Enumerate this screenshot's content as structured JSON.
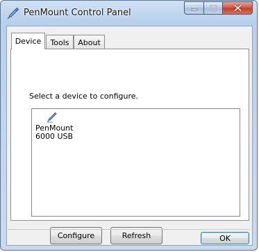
{
  "window": {
    "title": "PenMount Control Panel",
    "app_icon": "pen-icon",
    "caption_buttons": [
      "minimize-icon",
      "maximize-icon",
      "close-icon"
    ]
  },
  "tabs": [
    {
      "label": "Device",
      "selected": true
    },
    {
      "label": "Tools",
      "selected": false
    },
    {
      "label": "About",
      "selected": false
    }
  ],
  "device_tab": {
    "prompt": "Select a device to configure.",
    "devices": [
      {
        "icon": "pen-icon",
        "name_line1": "PenMount",
        "name_line2": "6000 USB"
      }
    ],
    "configure_label": "Configure",
    "refresh_label": "Refresh"
  },
  "footer": {
    "ok_label": "OK"
  },
  "colors": {
    "close_button": "#c13e24",
    "frame": "#b8d0ec"
  }
}
